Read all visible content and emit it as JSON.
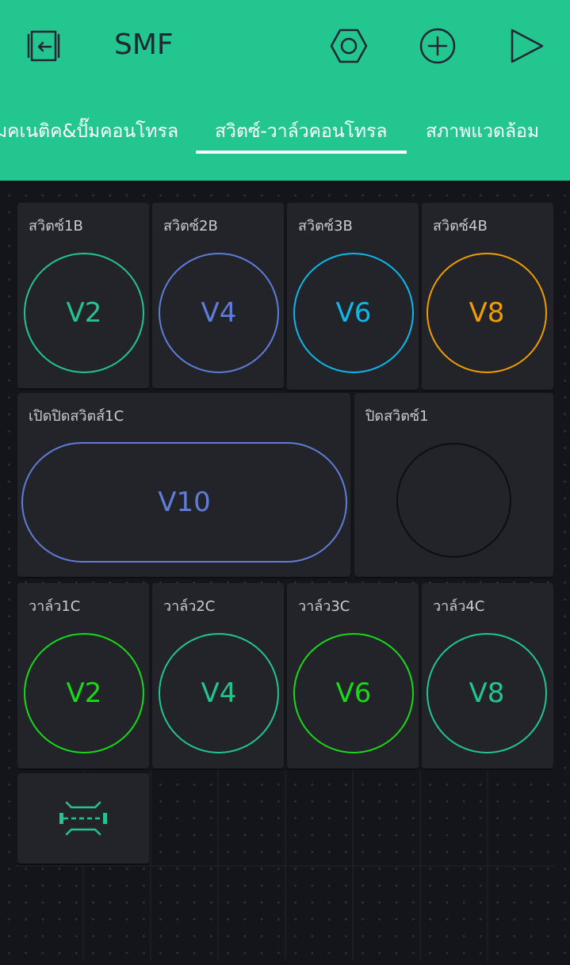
{
  "app": {
    "title": "SMF"
  },
  "toolbar": {
    "back_icon": "exit-icon",
    "settings_icon": "hexagon-settings-icon",
    "add_icon": "plus-circle-icon",
    "play_icon": "play-icon"
  },
  "tabs": [
    {
      "label": "มคเนติค&ปั๊มคอนโทรล",
      "active": false
    },
    {
      "label": "สวิตซ์-วาล์วคอนโทรล",
      "active": true
    },
    {
      "label": "สภาพแวดล้อม",
      "active": false
    }
  ],
  "colors": {
    "header_bg": "#24c690",
    "canvas_bg": "#13151b",
    "widget_bg": "#222429",
    "green": "#23c48e",
    "indigo": "#5f7cd8",
    "cyan": "#0ab8eb",
    "orange": "#ed9d00",
    "lime": "#18d818"
  },
  "switch_row": [
    {
      "label": "สวิตซ์1B",
      "pin": "V2",
      "color": "#23c48e"
    },
    {
      "label": "สวิตซ์2B",
      "pin": "V4",
      "color": "#5f7cd8"
    },
    {
      "label": "สวิตซ์3B",
      "pin": "V6",
      "color": "#0ab8eb"
    },
    {
      "label": "สวิตซ์4B",
      "pin": "V8",
      "color": "#ed9d00"
    }
  ],
  "wide_switch": {
    "label": "เปิดปิดสวิตส์1C",
    "pin": "V10",
    "color": "#5f7cd8"
  },
  "off_switch": {
    "label": "ปิดสวิตซ์1",
    "pin": "",
    "color": "#0d0e12"
  },
  "valve_row": [
    {
      "label": "วาล์ว1C",
      "pin": "V2",
      "color": "#18d818"
    },
    {
      "label": "วาล์ว2C",
      "pin": "V4",
      "color": "#23c48e"
    },
    {
      "label": "วาล์ว3C",
      "pin": "V6",
      "color": "#18d818"
    },
    {
      "label": "วาล์ว4C",
      "pin": "V8",
      "color": "#23c48e"
    }
  ],
  "spacer_widget": {
    "icon": "resize-spacer-icon"
  }
}
